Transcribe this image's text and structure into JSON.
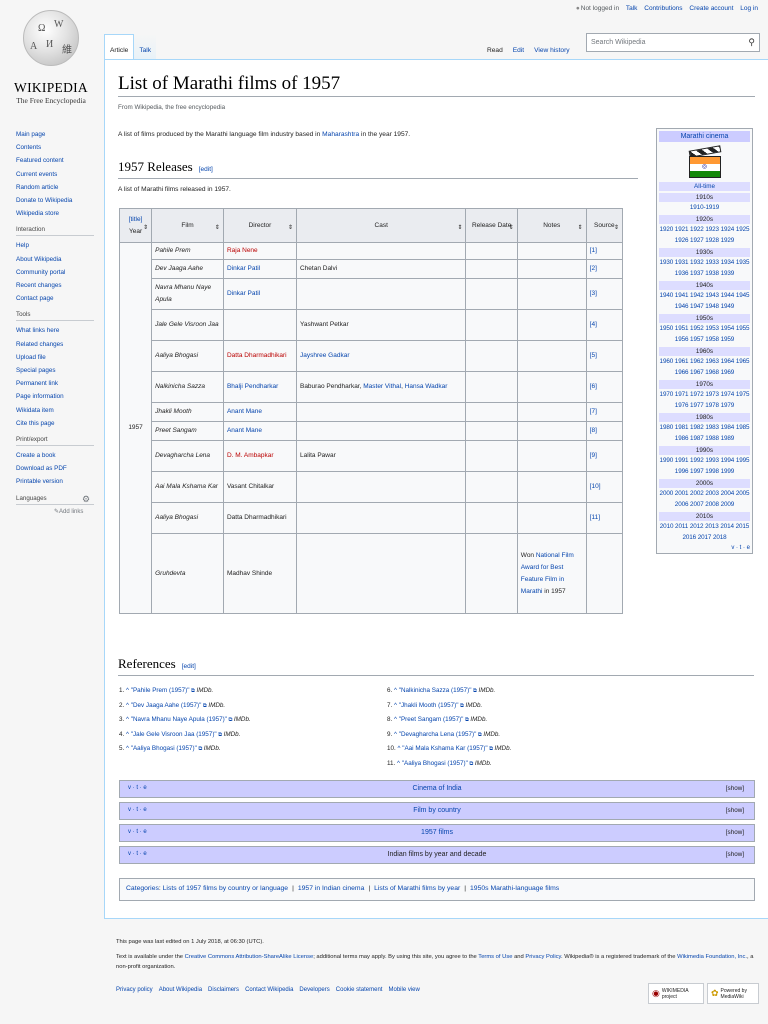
{
  "logo": {
    "wordmark": "Wikipedia",
    "tagline": "The Free Encyclopedia"
  },
  "personal": {
    "not_logged_in": "Not logged in",
    "talk": "Talk",
    "contributions": "Contributions",
    "create_account": "Create account",
    "log_in": "Log in"
  },
  "tabs": {
    "article": "Article",
    "talk": "Talk",
    "read": "Read",
    "edit": "Edit",
    "view_history": "View history"
  },
  "search": {
    "placeholder": "Search Wikipedia"
  },
  "sidebar": {
    "main": [
      "Main page",
      "Contents",
      "Featured content",
      "Current events",
      "Random article",
      "Donate to Wikipedia",
      "Wikipedia store"
    ],
    "interaction_title": "Interaction",
    "interaction": [
      "Help",
      "About Wikipedia",
      "Community portal",
      "Recent changes",
      "Contact page"
    ],
    "tools_title": "Tools",
    "tools": [
      "What links here",
      "Related changes",
      "Upload file",
      "Special pages",
      "Permanent link",
      "Page information",
      "Wikidata item",
      "Cite this page"
    ],
    "print_title": "Print/export",
    "print": [
      "Create a book",
      "Download as PDF",
      "Printable version"
    ],
    "languages_title": "Languages",
    "add_links": "Add links"
  },
  "article": {
    "title": "List of Marathi films of 1957",
    "from": "From Wikipedia, the free encyclopedia",
    "intro_pre": "A list of films produced by the Marathi language film industry based in ",
    "intro_link": "Maharashtra",
    "intro_post": " in the year 1957.",
    "releases_heading": "1957 Releases",
    "edit": "[edit]",
    "releases_intro": "A list of Marathi films released in 1957."
  },
  "table": {
    "headers": {
      "year_link": "[title]",
      "year": "Year",
      "film": "Film",
      "director": "Director",
      "cast": "Cast",
      "release": "Release Date",
      "notes": "Notes",
      "source": "Source"
    },
    "year": "1957",
    "rows": [
      {
        "film": "Pahile Prem",
        "director": "Raja Nene",
        "dir_red": true,
        "cast": "",
        "notes": "",
        "source": "[1]"
      },
      {
        "film": "Dev Jaaga Aahe",
        "director": "Dinkar Patil",
        "dir_red": false,
        "cast": "Chetan Dalvi",
        "notes": "",
        "source": "[2]"
      },
      {
        "film": "Navra Mhanu Naye Apula",
        "director": "Dinkar Patil",
        "dir_red": false,
        "cast": "",
        "notes": "",
        "source": "[3]"
      },
      {
        "film": "Jale Gele Visroon Jaa",
        "director": "",
        "dir_red": false,
        "cast": "Yashwant Petkar",
        "notes": "",
        "source": "[4]"
      },
      {
        "film": "Aaliya Bhogasi",
        "director": "Datta Dharmadhikari",
        "dir_red": true,
        "cast": "Jayshree Gadkar",
        "cast_link": true,
        "notes": "",
        "source": "[5]"
      },
      {
        "film": "Nalkinicha Sazza",
        "director": "Bhalji Pendharkar",
        "dir_red": false,
        "cast_parts": [
          "Baburao Pendharkar, ",
          "Master Vithal",
          ", ",
          "Hansa Wadkar"
        ],
        "notes": "",
        "source": "[6]"
      },
      {
        "film": "Jhakli Mooth",
        "director": "Anant Mane",
        "dir_red": false,
        "cast": "",
        "notes": "",
        "source": "[7]"
      },
      {
        "film": "Preet Sangam",
        "director": "Anant Mane",
        "dir_red": false,
        "cast": "",
        "notes": "",
        "source": "[8]"
      },
      {
        "film": "Devagharcha Lena",
        "director": "D. M. Ambapkar",
        "dir_red": true,
        "cast": "Lalita Pawar",
        "notes": "",
        "source": "[9]"
      },
      {
        "film": "Aai Mala Kshama Kar",
        "director": "Vasant Chitalkar",
        "dir_plain": true,
        "cast": "",
        "notes": "",
        "source": "[10]"
      },
      {
        "film": "Aaliya Bhogasi",
        "director": "Datta Dharmadhikari",
        "dir_plain": true,
        "cast": "",
        "notes": "",
        "source": "[11]"
      },
      {
        "film": "Gruhdevta",
        "director": "Madhav Shinde",
        "dir_plain": true,
        "cast": "",
        "notes_pre": "Won ",
        "notes_link": "National Film Award for Best Feature Film in Marathi",
        "notes_post": " in 1957",
        "source": ""
      }
    ]
  },
  "navbox_side": {
    "title": "Marathi cinema",
    "alltime": "All-time",
    "d1910_h": "1910s",
    "d1910": "1910-1919",
    "d1920_h": "1920s",
    "d1920": "1920 1921 1922 1923 1924 1925 1926 1927 1928 1929",
    "d1930_h": "1930s",
    "d1930": "1930 1931 1932 1933 1934 1935 1936 1937 1938 1939",
    "d1940_h": "1940s",
    "d1940": "1940 1941 1942 1943 1944 1945 1946 1947 1948 1949",
    "d1950_h": "1950s",
    "d1950": "1950 1951 1952 1953 1954 1955 1956 1957 1958 1959",
    "d1960_h": "1960s",
    "d1960": "1960 1961 1962 1963 1964 1965 1966 1967 1968 1969",
    "d1970_h": "1970s",
    "d1970": "1970 1971 1972 1973 1974 1975 1976 1977 1978 1979",
    "d1980_h": "1980s",
    "d1980": "1980 1981 1982 1983 1984 1985 1986 1987 1988 1989",
    "d1990_h": "1990s",
    "d1990": "1990 1991 1992 1993 1994 1995 1996 1997 1998 1999",
    "d2000_h": "2000s",
    "d2000": "2000 2001 2002 2003 2004 2005 2006 2007 2008 2009",
    "d2010_h": "2010s",
    "d2010": "2010 2011 2012 2013 2014 2015 2016 2017 2018",
    "vte": "v · t · e"
  },
  "references": {
    "heading": "References",
    "edit": "[edit]",
    "left": [
      {
        "n": "1.",
        "title": "\"Pahile Prem (1957)\"",
        "pub": "IMDb."
      },
      {
        "n": "2.",
        "title": "\"Dev Jaaga Aahe (1957)\"",
        "pub": "IMDb."
      },
      {
        "n": "3.",
        "title": "\"Navra Mhanu Naye Apula (1957)\"",
        "pub": "IMDb."
      },
      {
        "n": "4.",
        "title": "\"Jale Gele Visroon Jaa (1957)\"",
        "pub": "IMDb."
      },
      {
        "n": "5.",
        "title": "\"Aaliya Bhogasi (1957)\"",
        "pub": "IMDb."
      }
    ],
    "right": [
      {
        "n": "6.",
        "title": "\"Nalkinicha Sazza (1957)\"",
        "pub": "IMDb."
      },
      {
        "n": "7.",
        "title": "\"Jhakli Mooth (1957)\"",
        "pub": "IMDb."
      },
      {
        "n": "8.",
        "title": "\"Preet Sangam (1957)\"",
        "pub": "IMDb."
      },
      {
        "n": "9.",
        "title": "\"Devagharcha Lena (1957)\"",
        "pub": "IMDb."
      },
      {
        "n": "10.",
        "title": "\"Aai Mala Kshama Kar (1957)\"",
        "pub": "IMDb."
      },
      {
        "n": "11.",
        "title": "\"Aaliya Bhogasi (1957)\"",
        "pub": "IMDb."
      }
    ]
  },
  "navboxes": [
    {
      "vte": "v · t · e",
      "title": "Cinema of India",
      "show": "[show]"
    },
    {
      "vte": "v · t · e",
      "title": "Film by country",
      "show": "[show]"
    },
    {
      "vte": "v · t · e",
      "title": "1957 films",
      "show": "[show]"
    },
    {
      "vte": "v · t · e",
      "title": "Indian films by year and decade",
      "show": "[show]"
    }
  ],
  "categories": {
    "label": "Categories",
    "items": [
      "Lists of 1957 films by country or language",
      "1957 in Indian cinema",
      "Lists of Marathi films by year",
      "1950s Marathi-language films"
    ]
  },
  "footer": {
    "last_edited": "This page was last edited on 1 July 2018, at 06:30 (UTC).",
    "license_1": "Text is available under the ",
    "license_link": "Creative Commons Attribution-ShareAlike License",
    "license_2": "; additional terms may apply. By using this site, you agree to the ",
    "terms": "Terms of Use",
    "and": " and ",
    "privacy": "Privacy Policy",
    "license_3": ". Wikipedia® is a registered trademark of the ",
    "wmf": "Wikimedia Foundation, Inc.",
    "license_4": ", a non-profit organization.",
    "links": [
      "Privacy policy",
      "About Wikipedia",
      "Disclaimers",
      "Contact Wikipedia",
      "Developers",
      "Cookie statement",
      "Mobile view"
    ],
    "wmf_badge": "WIKIMEDIA project",
    "mw_badge": "Powered by MediaWiki"
  },
  "colors": {
    "link": "#0645ad",
    "redlink": "#ba0000",
    "border": "#a7d7f9",
    "navbox_header": "#ccccff"
  }
}
